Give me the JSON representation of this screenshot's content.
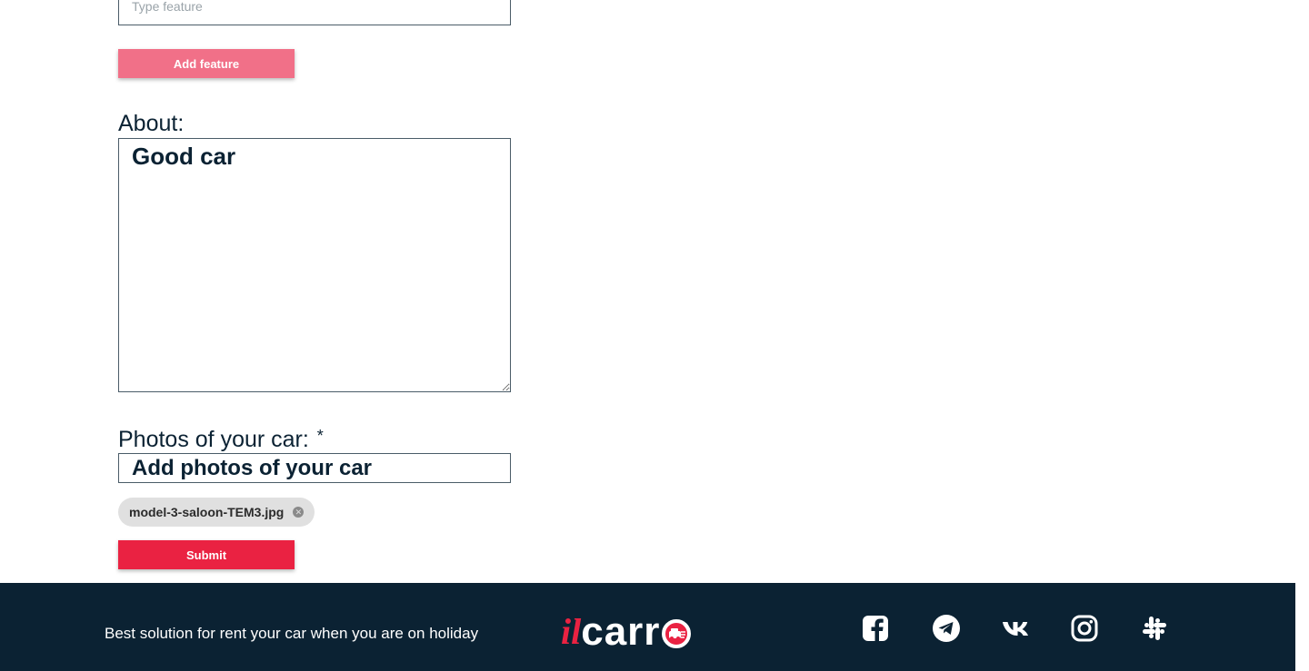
{
  "feature": {
    "placeholder": "Type feature",
    "add_button_label": "Add feature"
  },
  "about": {
    "label": "About:",
    "value": "Good car"
  },
  "photos": {
    "label": "Photos of your car:",
    "required_mark": "*",
    "add_label": "Add photos of your car",
    "files": [
      {
        "name": "model-3-saloon-TEM3.jpg"
      }
    ]
  },
  "submit_label": "Submit",
  "footer": {
    "tagline": "Best solution for rent your car when you are on holiday",
    "logo": {
      "prefix": "il",
      "main": "carr"
    },
    "social_icons": [
      "facebook-icon",
      "telegram-icon",
      "vk-icon",
      "instagram-icon",
      "slack-icon"
    ]
  },
  "colors": {
    "navy": "#0b2233",
    "accent_red": "#ea2242",
    "accent_pink": "#f17088",
    "chip_bg": "#e0e0e0"
  }
}
